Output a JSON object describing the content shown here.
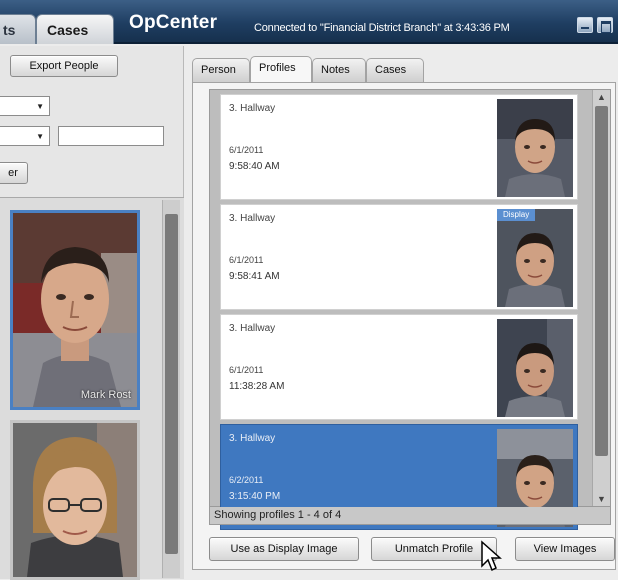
{
  "header": {
    "tabs": [
      {
        "label": "ts"
      },
      {
        "label": "Cases"
      }
    ],
    "app_name": "OpCenter",
    "connection_status": "Connected to \"Financial District Branch\" at 3:43:36 PM"
  },
  "left_panel": {
    "export_button": "Export People",
    "filter_button": "er",
    "search_value": "",
    "thumbnails": [
      {
        "label": "Mark Rost"
      },
      {
        "label": ""
      }
    ]
  },
  "right_panel": {
    "tabs": [
      {
        "label": "Person"
      },
      {
        "label": "Profiles"
      },
      {
        "label": "Notes"
      },
      {
        "label": "Cases"
      }
    ],
    "profiles": [
      {
        "location": "3. Hallway",
        "date": "6/1/2011",
        "time": "9:58:40 AM",
        "badge": "",
        "selected": false
      },
      {
        "location": "3. Hallway",
        "date": "6/1/2011",
        "time": "9:58:41 AM",
        "badge": "Display",
        "selected": false
      },
      {
        "location": "3. Hallway",
        "date": "6/1/2011",
        "time": "11:38:28 AM",
        "badge": "",
        "selected": false
      },
      {
        "location": "3. Hallway",
        "date": "6/2/2011",
        "time": "3:15:40 PM",
        "badge": "",
        "selected": true
      }
    ],
    "status_text": "Showing profiles 1 - 4 of 4",
    "buttons": {
      "display_image": "Use as Display Image",
      "unmatch": "Unmatch Profile",
      "view_images": "View Images"
    }
  },
  "colors": {
    "header_bg": "#1f3e62",
    "selection": "#3f78c0",
    "badge": "#5b8fd0"
  }
}
